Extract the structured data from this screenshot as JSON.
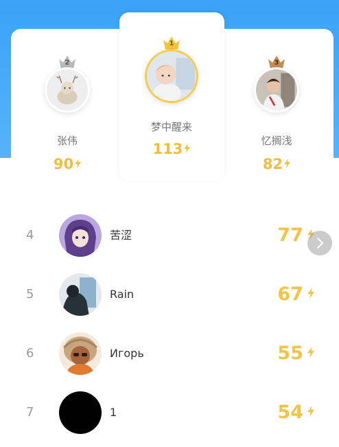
{
  "leaderboard": {
    "podium": [
      {
        "rank": "2",
        "name": "张伟",
        "score": "90",
        "crown_color": "#b9b9b9"
      },
      {
        "rank": "1",
        "name": "梦中醒来",
        "score": "113",
        "crown_color": "#f3c538"
      },
      {
        "rank": "3",
        "name": "忆搁浅",
        "score": "82",
        "crown_color": "#c88c55"
      }
    ],
    "rows": [
      {
        "rank": "4",
        "name": "苦涩",
        "score": "77"
      },
      {
        "rank": "5",
        "name": "Rain",
        "score": "67"
      },
      {
        "rank": "6",
        "name": "Игорь",
        "score": "55"
      },
      {
        "rank": "7",
        "name": "1",
        "score": "54"
      }
    ]
  },
  "colors": {
    "header_blue": "#3aa2f7",
    "score_gold": "#f2c445",
    "rank_gray": "#999999"
  },
  "icons": {
    "score_icon": "lightning-bolt-icon",
    "crown_icon": "crown-icon",
    "scroll_icon": "chevron-right-icon"
  }
}
